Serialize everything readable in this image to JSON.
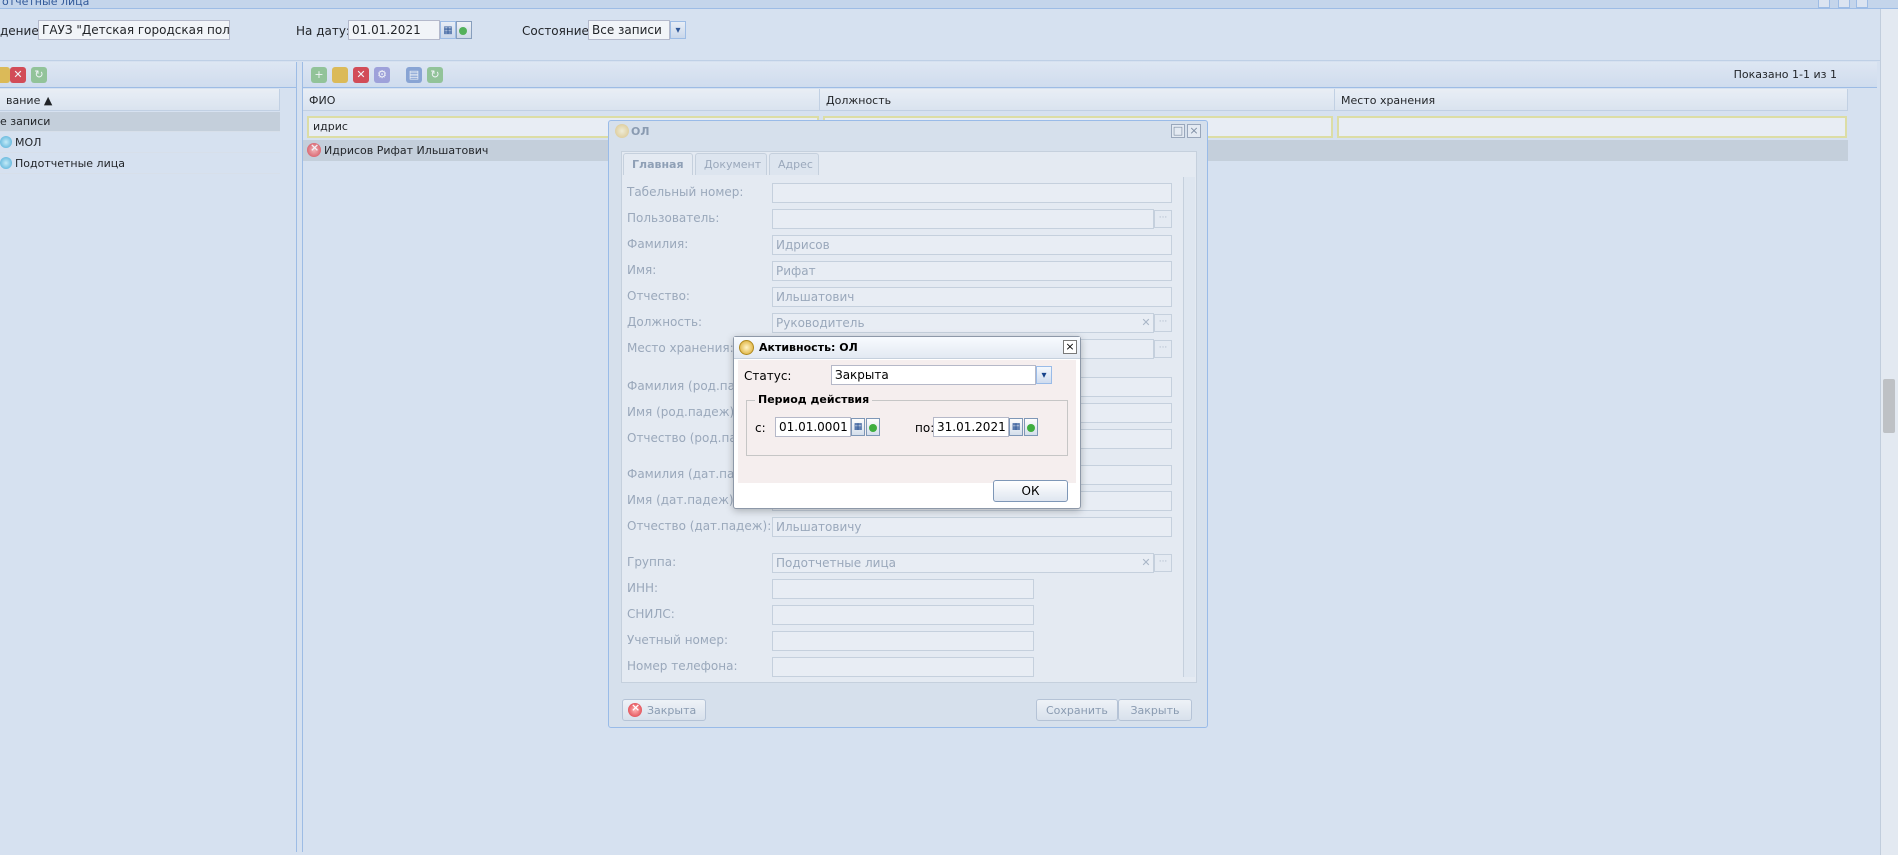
{
  "window": {
    "title": "отчетные лица"
  },
  "filters": {
    "org_label": "дение:",
    "org_value": "ГАУЗ \"Детская городская поликлі",
    "date_label": "На дату:",
    "date_value": "01.01.2021",
    "state_label": "Состояние:",
    "state_value": "Все записи"
  },
  "left": {
    "col_header": "вание ▲",
    "items": [
      {
        "label": "е записи"
      },
      {
        "label": "МОЛ"
      },
      {
        "label": "Подотчетные лица"
      }
    ]
  },
  "grid": {
    "shown_text": "Показано 1-1 из 1",
    "columns": [
      "ФИО",
      "Должность",
      "Место хранения"
    ],
    "filter_value": "идрис",
    "rows": [
      {
        "fio": "Идрисов Рифат Ильшатович"
      }
    ]
  },
  "ol_window": {
    "title": "ОЛ",
    "tabs": [
      "Главная",
      "Документ",
      "Адрес"
    ],
    "fields": [
      {
        "label": "Табельный номер:",
        "value": ""
      },
      {
        "label": "Пользователь:",
        "value": ""
      },
      {
        "label": "Фамилия:",
        "value": "Идрисов"
      },
      {
        "label": "Имя:",
        "value": "Рифат"
      },
      {
        "label": "Отчество:",
        "value": "Ильшатович"
      },
      {
        "label": "Должность:",
        "value": "Руководитель"
      },
      {
        "label": "Место хранения:",
        "value": ""
      },
      {
        "label": "Фамилия (род.паде",
        "value": ""
      },
      {
        "label": "Имя (род.падеж):",
        "value": ""
      },
      {
        "label": "Отчество (род.паде",
        "value": ""
      },
      {
        "label": "Фамилия (дат.паде",
        "value": ""
      },
      {
        "label": "Имя (дат.падеж):",
        "value": ""
      },
      {
        "label": "Отчество (дат.падеж):",
        "value": "Ильшатовичу"
      },
      {
        "label": "Группа:",
        "value": "Подотчетные лица"
      },
      {
        "label": "ИНН:",
        "value": ""
      },
      {
        "label": "СНИЛС:",
        "value": ""
      },
      {
        "label": "Учетный номер:",
        "value": ""
      },
      {
        "label": "Номер телефона:",
        "value": ""
      }
    ],
    "close_status_button": "Закрыта",
    "save_button": "Сохранить",
    "close_button": "Закрыть"
  },
  "activity_dialog": {
    "title": "Активность: ОЛ",
    "status_label": "Статус:",
    "status_value": "Закрыта",
    "period_legend": "Период действия",
    "from_label": "с:",
    "from_value": "01.01.0001",
    "to_label": "по:",
    "to_value": "31.01.2021",
    "ok_button": "ОК"
  },
  "colors": {
    "accent": "#15428b",
    "panel_bg": "#dfe8f6",
    "border": "#99bbe8",
    "filter_highlight": "#e6e39a",
    "dialog_body": "#f5eeee"
  }
}
